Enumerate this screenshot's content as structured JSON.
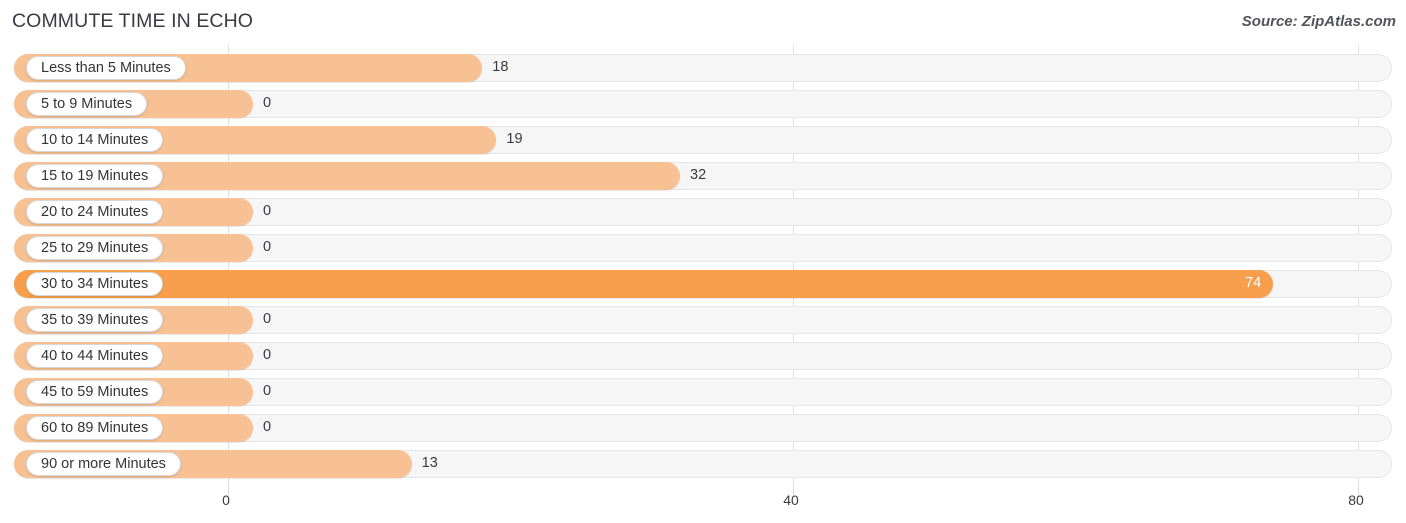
{
  "header": {
    "title": "COMMUTE TIME IN ECHO",
    "source": "Source: ZipAtlas.com"
  },
  "chart_data": {
    "type": "bar",
    "orientation": "horizontal",
    "title": "COMMUTE TIME IN ECHO",
    "xlabel": "",
    "ylabel": "",
    "xlim": [
      0,
      80
    ],
    "xticks": [
      0,
      40,
      80
    ],
    "xtick_labels": [
      "0",
      "40",
      "80"
    ],
    "grid": true,
    "legend": false,
    "categories": [
      "Less than 5 Minutes",
      "5 to 9 Minutes",
      "10 to 14 Minutes",
      "15 to 19 Minutes",
      "20 to 24 Minutes",
      "25 to 29 Minutes",
      "30 to 34 Minutes",
      "35 to 39 Minutes",
      "40 to 44 Minutes",
      "45 to 59 Minutes",
      "60 to 89 Minutes",
      "90 or more Minutes"
    ],
    "values": [
      18,
      0,
      19,
      32,
      0,
      0,
      74,
      0,
      0,
      0,
      0,
      13
    ],
    "value_labels": [
      "18",
      "0",
      "19",
      "32",
      "0",
      "0",
      "74",
      "0",
      "0",
      "0",
      "0",
      "13"
    ],
    "highlight_index": 6,
    "colors": {
      "bar": "#f8c193",
      "bar_highlight": "#f79f4c",
      "track": "#f6f6f7",
      "track_border": "#e4e4e6",
      "grid": "#e2e2e4",
      "text": "#33333a",
      "value_inside_text": "#ffffff"
    }
  }
}
